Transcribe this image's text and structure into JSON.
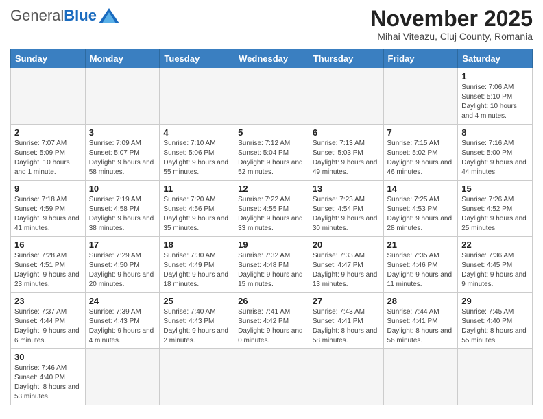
{
  "logo": {
    "general": "General",
    "blue": "Blue"
  },
  "title": "November 2025",
  "subtitle": "Mihai Viteazu, Cluj County, Romania",
  "weekdays": [
    "Sunday",
    "Monday",
    "Tuesday",
    "Wednesday",
    "Thursday",
    "Friday",
    "Saturday"
  ],
  "weeks": [
    [
      {
        "day": "",
        "info": ""
      },
      {
        "day": "",
        "info": ""
      },
      {
        "day": "",
        "info": ""
      },
      {
        "day": "",
        "info": ""
      },
      {
        "day": "",
        "info": ""
      },
      {
        "day": "",
        "info": ""
      },
      {
        "day": "1",
        "info": "Sunrise: 7:06 AM\nSunset: 5:10 PM\nDaylight: 10 hours\nand 4 minutes."
      }
    ],
    [
      {
        "day": "2",
        "info": "Sunrise: 7:07 AM\nSunset: 5:09 PM\nDaylight: 10 hours\nand 1 minute."
      },
      {
        "day": "3",
        "info": "Sunrise: 7:09 AM\nSunset: 5:07 PM\nDaylight: 9 hours\nand 58 minutes."
      },
      {
        "day": "4",
        "info": "Sunrise: 7:10 AM\nSunset: 5:06 PM\nDaylight: 9 hours\nand 55 minutes."
      },
      {
        "day": "5",
        "info": "Sunrise: 7:12 AM\nSunset: 5:04 PM\nDaylight: 9 hours\nand 52 minutes."
      },
      {
        "day": "6",
        "info": "Sunrise: 7:13 AM\nSunset: 5:03 PM\nDaylight: 9 hours\nand 49 minutes."
      },
      {
        "day": "7",
        "info": "Sunrise: 7:15 AM\nSunset: 5:02 PM\nDaylight: 9 hours\nand 46 minutes."
      },
      {
        "day": "8",
        "info": "Sunrise: 7:16 AM\nSunset: 5:00 PM\nDaylight: 9 hours\nand 44 minutes."
      }
    ],
    [
      {
        "day": "9",
        "info": "Sunrise: 7:18 AM\nSunset: 4:59 PM\nDaylight: 9 hours\nand 41 minutes."
      },
      {
        "day": "10",
        "info": "Sunrise: 7:19 AM\nSunset: 4:58 PM\nDaylight: 9 hours\nand 38 minutes."
      },
      {
        "day": "11",
        "info": "Sunrise: 7:20 AM\nSunset: 4:56 PM\nDaylight: 9 hours\nand 35 minutes."
      },
      {
        "day": "12",
        "info": "Sunrise: 7:22 AM\nSunset: 4:55 PM\nDaylight: 9 hours\nand 33 minutes."
      },
      {
        "day": "13",
        "info": "Sunrise: 7:23 AM\nSunset: 4:54 PM\nDaylight: 9 hours\nand 30 minutes."
      },
      {
        "day": "14",
        "info": "Sunrise: 7:25 AM\nSunset: 4:53 PM\nDaylight: 9 hours\nand 28 minutes."
      },
      {
        "day": "15",
        "info": "Sunrise: 7:26 AM\nSunset: 4:52 PM\nDaylight: 9 hours\nand 25 minutes."
      }
    ],
    [
      {
        "day": "16",
        "info": "Sunrise: 7:28 AM\nSunset: 4:51 PM\nDaylight: 9 hours\nand 23 minutes."
      },
      {
        "day": "17",
        "info": "Sunrise: 7:29 AM\nSunset: 4:50 PM\nDaylight: 9 hours\nand 20 minutes."
      },
      {
        "day": "18",
        "info": "Sunrise: 7:30 AM\nSunset: 4:49 PM\nDaylight: 9 hours\nand 18 minutes."
      },
      {
        "day": "19",
        "info": "Sunrise: 7:32 AM\nSunset: 4:48 PM\nDaylight: 9 hours\nand 15 minutes."
      },
      {
        "day": "20",
        "info": "Sunrise: 7:33 AM\nSunset: 4:47 PM\nDaylight: 9 hours\nand 13 minutes."
      },
      {
        "day": "21",
        "info": "Sunrise: 7:35 AM\nSunset: 4:46 PM\nDaylight: 9 hours\nand 11 minutes."
      },
      {
        "day": "22",
        "info": "Sunrise: 7:36 AM\nSunset: 4:45 PM\nDaylight: 9 hours\nand 9 minutes."
      }
    ],
    [
      {
        "day": "23",
        "info": "Sunrise: 7:37 AM\nSunset: 4:44 PM\nDaylight: 9 hours\nand 6 minutes."
      },
      {
        "day": "24",
        "info": "Sunrise: 7:39 AM\nSunset: 4:43 PM\nDaylight: 9 hours\nand 4 minutes."
      },
      {
        "day": "25",
        "info": "Sunrise: 7:40 AM\nSunset: 4:43 PM\nDaylight: 9 hours\nand 2 minutes."
      },
      {
        "day": "26",
        "info": "Sunrise: 7:41 AM\nSunset: 4:42 PM\nDaylight: 9 hours\nand 0 minutes."
      },
      {
        "day": "27",
        "info": "Sunrise: 7:43 AM\nSunset: 4:41 PM\nDaylight: 8 hours\nand 58 minutes."
      },
      {
        "day": "28",
        "info": "Sunrise: 7:44 AM\nSunset: 4:41 PM\nDaylight: 8 hours\nand 56 minutes."
      },
      {
        "day": "29",
        "info": "Sunrise: 7:45 AM\nSunset: 4:40 PM\nDaylight: 8 hours\nand 55 minutes."
      }
    ],
    [
      {
        "day": "30",
        "info": "Sunrise: 7:46 AM\nSunset: 4:40 PM\nDaylight: 8 hours\nand 53 minutes."
      },
      {
        "day": "",
        "info": ""
      },
      {
        "day": "",
        "info": ""
      },
      {
        "day": "",
        "info": ""
      },
      {
        "day": "",
        "info": ""
      },
      {
        "day": "",
        "info": ""
      },
      {
        "day": "",
        "info": ""
      }
    ]
  ]
}
